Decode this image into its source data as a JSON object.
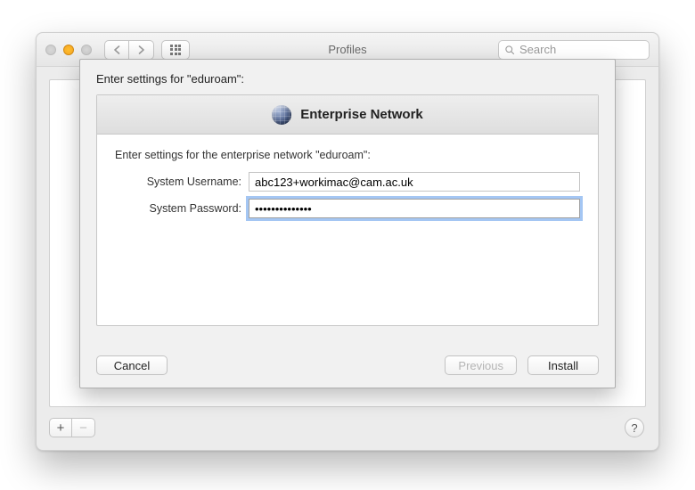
{
  "window": {
    "title": "Profiles",
    "search_placeholder": "Search",
    "add_label": "+",
    "remove_label": "−",
    "help_label": "?"
  },
  "sheet": {
    "intro": "Enter settings for \"eduroam\":",
    "panel_title": "Enterprise Network",
    "instruction": "Enter settings for the enterprise network \"eduroam\":",
    "username_label": "System Username:",
    "username_value": "abc123+workimac@cam.ac.uk",
    "password_label": "System Password:",
    "password_value": "••••••••••••••",
    "buttons": {
      "cancel": "Cancel",
      "previous": "Previous",
      "install": "Install"
    }
  }
}
